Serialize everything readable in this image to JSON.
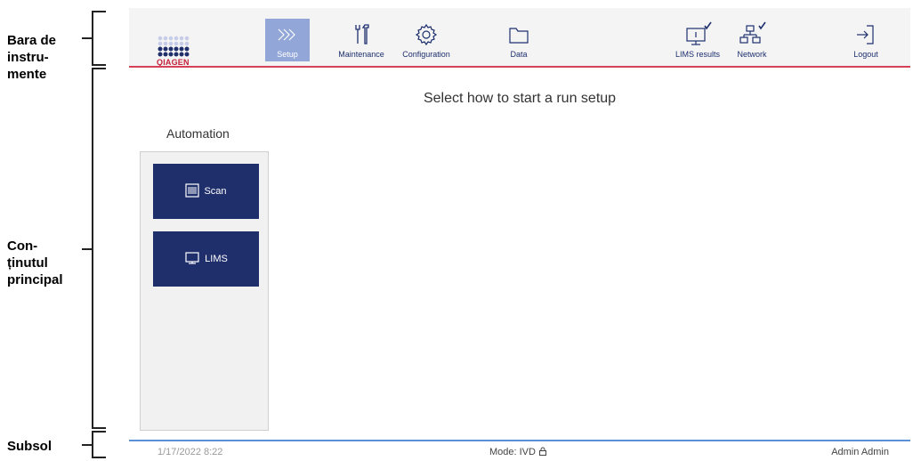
{
  "annotations": {
    "toolbar": "Bara de instru-mente",
    "toolbar_lines": [
      "Bara de",
      "instru-",
      "mente"
    ],
    "main_lines": [
      "Con-",
      "ținutul",
      "principal"
    ],
    "footer": "Subsol"
  },
  "logo": {
    "text": "QIAGEN",
    "color": "#c4203a"
  },
  "toolbar": {
    "items": [
      {
        "label": "Setup",
        "icon": "chevrons-right-icon",
        "active": true
      },
      {
        "label": "Maintenance",
        "icon": "tools-icon"
      },
      {
        "label": "Configuration",
        "icon": "gear-icon"
      },
      {
        "label": "Data",
        "icon": "folder-icon"
      },
      {
        "label": "LIMS results",
        "icon": "monitor-check-icon"
      },
      {
        "label": "Network",
        "icon": "network-check-icon"
      },
      {
        "label": "Logout",
        "icon": "logout-icon"
      }
    ],
    "accent_line_color": "#d6415a",
    "active_bg": "#92a7d8"
  },
  "main": {
    "title": "Select how to start a run setup",
    "section_label": "Automation",
    "buttons": [
      {
        "label": "Scan",
        "icon": "barcode-scan-icon"
      },
      {
        "label": "LIMS",
        "icon": "monitor-icon"
      }
    ],
    "button_color": "#1f2f6c"
  },
  "footer": {
    "timestamp": "1/17/2022 8:22",
    "mode": "Mode: IVD",
    "mode_icon": "lock-icon",
    "user": "Admin Admin",
    "line_color": "#5b8fd6"
  }
}
